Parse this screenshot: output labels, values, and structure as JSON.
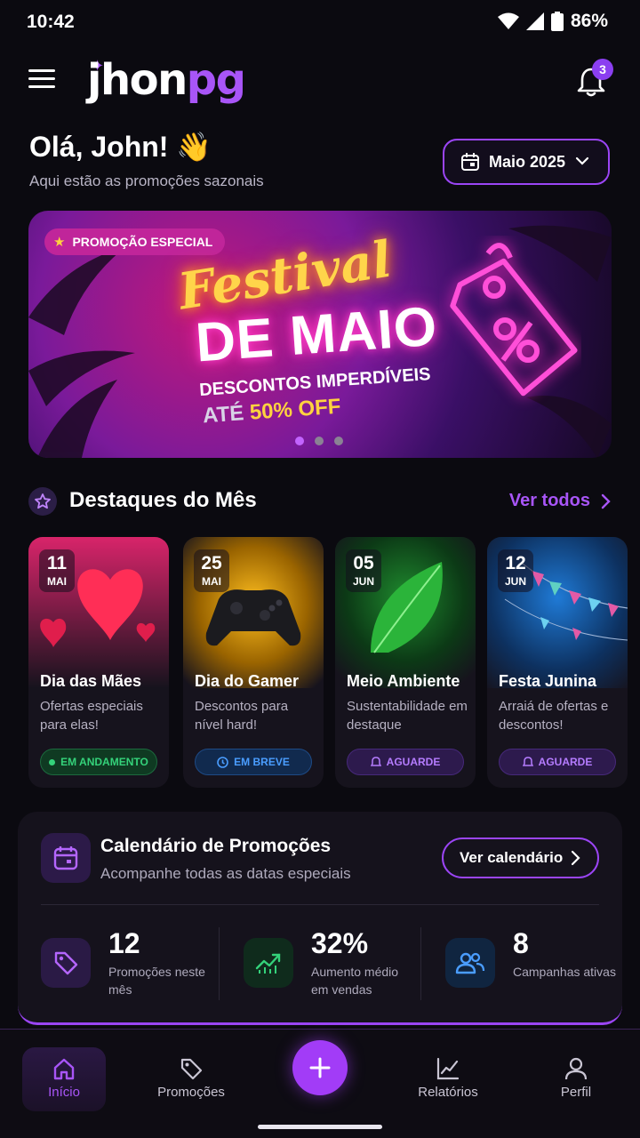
{
  "status": {
    "time": "10:42",
    "battery": "86%"
  },
  "header": {
    "logo_part1": "jhon",
    "logo_part2": "pg",
    "notifications": "3"
  },
  "greeting": {
    "title": "Olá, John! 👋",
    "subtitle": "Aqui estão as promoções sazonais"
  },
  "month_picker": {
    "label": "Maio 2025"
  },
  "banner": {
    "badge": "PROMOÇÃO ESPECIAL",
    "line1": "Festival",
    "line2": "DE MAIO",
    "line3": "DESCONTOS IMPERDÍVEIS",
    "line4_prefix": "ATÉ ",
    "line4_highlight": "50% OFF",
    "active_slide": 1,
    "slides": 3
  },
  "highlights": {
    "title": "Destaques do Mês",
    "see_all": "Ver todos",
    "cards": [
      {
        "day": "11",
        "month": "MAI",
        "title": "Dia das Mães",
        "desc": "Ofertas especiais para elas!",
        "status": "EM ANDAMENTO"
      },
      {
        "day": "25",
        "month": "MAI",
        "title": "Dia do Gamer",
        "desc": "Descontos para nível hard!",
        "status": "EM BREVE"
      },
      {
        "day": "05",
        "month": "JUN",
        "title": "Meio Ambiente",
        "desc": "Sustentabilidade em destaque",
        "status": "AGUARDE"
      },
      {
        "day": "12",
        "month": "JUN",
        "title": "Festa Junina",
        "desc": "Arraiá de ofertas e descontos!",
        "status": "AGUARDE"
      }
    ]
  },
  "calendar": {
    "title": "Calendário de Promoções",
    "subtitle": "Acompanhe todas as datas especiais",
    "button": "Ver calendário",
    "stats": [
      {
        "value": "12",
        "label": "Promoções neste mês"
      },
      {
        "value": "32%",
        "label": "Aumento médio em vendas"
      },
      {
        "value": "8",
        "label": "Campanhas ativas"
      }
    ]
  },
  "nav": {
    "items": [
      {
        "label": "Início"
      },
      {
        "label": "Promoções"
      },
      {
        "label": "Relatórios"
      },
      {
        "label": "Perfil"
      }
    ]
  },
  "colors": {
    "accent": "#a855f7",
    "bg": "#0b0a10",
    "green": "#34d27a",
    "blue": "#4a9dff"
  }
}
